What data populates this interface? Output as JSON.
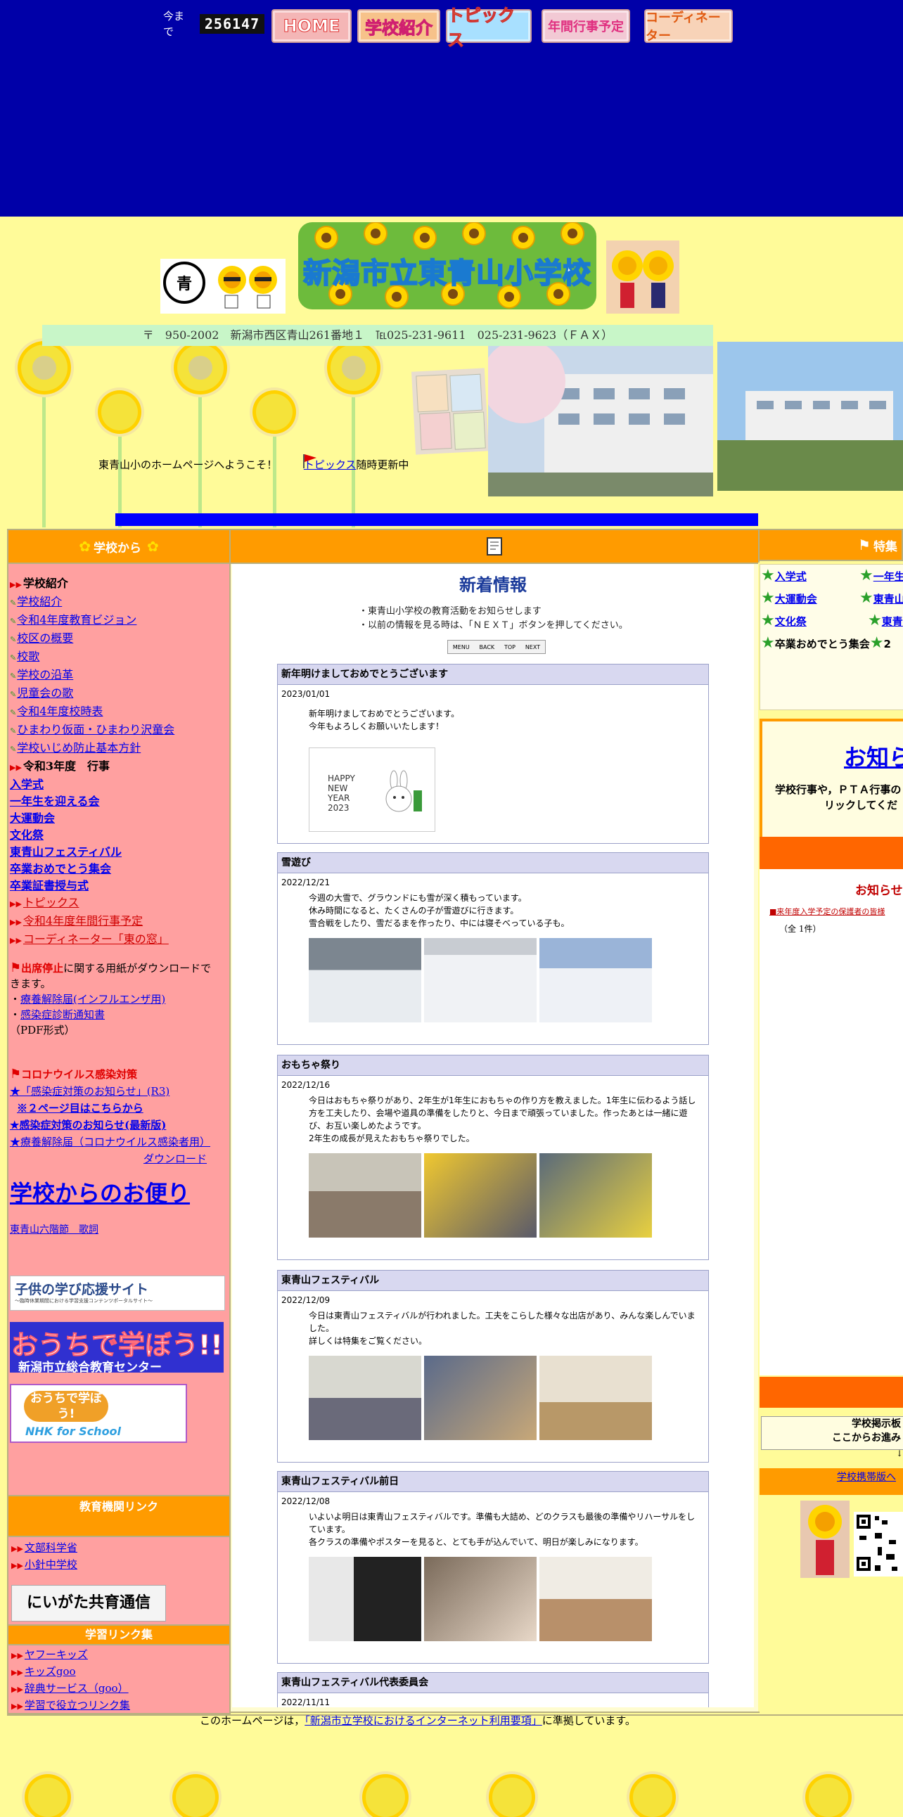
{
  "header": {
    "counter_label": "今まで",
    "counter_value": "256147",
    "nav": [
      "HOME",
      "学校紹介",
      "トピックス",
      "年間行事予定",
      "コーディネーター"
    ]
  },
  "banner": {
    "school_name": "新潟市立東青山小学校",
    "emblem_text": "青",
    "address": "〒　950-2002　新潟市西区青山261番地１　℡025-231-9611　025-231-9623（ＦＡＸ）",
    "welcome": "東青山小のホームページへようこそ！",
    "topics_link": "トピックス",
    "topics_suffix": "随時更新中"
  },
  "left": {
    "header": "学校から",
    "school_intro_title": "学校紹介",
    "school_intro": [
      "学校紹介",
      "令和4年度教育ビジョン",
      "校区の概要",
      "校歌",
      "学校の沿革",
      "児童会の歌",
      "令和4年度校時表",
      "ひまわり仮面・ひまわり沢童会",
      "学校いじめ防止基本方針"
    ],
    "events_title": "令和3年度　行事",
    "events": [
      "入学式",
      "一年生を迎える会",
      "大運動会",
      "文化祭",
      "東青山フェスティバル",
      "卒業おめでとう集会",
      "卒業証書授与式"
    ],
    "other_links": [
      "トピックス",
      "令和4年度年間行事予定",
      "コーディネーター「東の窓」"
    ],
    "attendance_title": "出席停止",
    "attendance_text": "に関する用紙がダウンロードできます。",
    "attendance_links": [
      "療養解除届(インフルエンザ用)",
      "感染症診断通知書"
    ],
    "pdf_note": "（PDF形式）",
    "corona_title": "コロナウイルス感染対策",
    "corona_link1": "★「感染症対策のお知らせ」(R3)",
    "corona_link2": "※２ページ目はこちらから",
    "corona_link3": "★感染症対策のお知らせ(最新版)",
    "corona_link4": "★療養解除届（コロナウイルス感染者用）",
    "download": "ダウンロード",
    "letters": "学校からのお便り",
    "song": "東青山六階節　歌詞",
    "banner1": "子供の学び応援サイト",
    "banner1_sub": "〜臨時休業期間における学習支援コンテンツポータルサイト〜",
    "banner2": "おうちで学ぼう!!",
    "banner2_sub": "新潟市立総合教育センター",
    "banner3": "おうちで学ぼう!",
    "banner3_sub": "NHK for School",
    "edu_links_title": "教育機関リンク",
    "edu_links": [
      "文部科学省",
      "小針中学校"
    ],
    "kyoiku_banner": "にいがた共育通信",
    "study_links_title": "学習リンク集",
    "study_links": [
      "ヤフーキッズ",
      "キッズgoo",
      "辞典サービス（goo）",
      "学習で役立つリンク集"
    ]
  },
  "news": {
    "title": "新着情報",
    "notes": [
      "・東青山小学校の教育活動をお知らせします",
      "・以前の情報を見る時は、「ＮＥＸＴ」ボタンを押してください。"
    ],
    "pager": [
      "MENU",
      "BACK",
      "TOP",
      "NEXT"
    ],
    "items": [
      {
        "title": "新年明けましておめでとうございます",
        "date": "2023/01/01",
        "body": "新年明けましておめでとうございます。\n今年もよろしくお願いいたします！",
        "card": [
          "HAPPY",
          "NEW",
          "YEAR",
          "2023"
        ]
      },
      {
        "title": "雪遊び",
        "date": "2022/12/21",
        "body": "今週の大雪で、グラウンドにも雪が深く積もっています。\n休み時間になると、たくさんの子が雪遊びに行きます。\n雪合戦をしたり、雪だるまを作ったり、中には寝そべっている子も。"
      },
      {
        "title": "おもちゃ祭り",
        "date": "2022/12/16",
        "body": "今日はおもちゃ祭りがあり、2年生が1年生におもちゃの作り方を教えました。1年生に伝わるよう話し方を工夫したり、会場や道具の準備をしたりと、今日まで頑張っていました。作ったあとは一緒に遊び、お互い楽しめたようです。\n2年生の成長が見えたおもちゃ祭りでした。"
      },
      {
        "title": "東青山フェスティバル",
        "date": "2022/12/09",
        "body": "今日は東青山フェスティバルが行われました。工夫をこらした様々な出店があり、みんな楽しんでいました。\n詳しくは特集をご覧ください。"
      },
      {
        "title": "東青山フェスティバル前日",
        "date": "2022/12/08",
        "body": "いよいよ明日は東青山フェスティバルです。準備も大詰め、どのクラスも最後の準備やリハーサルをしています。\n各クラスの準備やポスターを見ると、とても手が込んでいて、明日が楽しみになります。"
      },
      {
        "title": "東青山フェスティバル代表委員会",
        "date": "2022/11/11",
        "body": ""
      }
    ]
  },
  "right": {
    "header": "特集",
    "features": [
      "入学式",
      "一年生",
      "大運動会",
      "東青山",
      "文化祭",
      "東青",
      "卒業おめでとう集会",
      "2"
    ],
    "notice_link": "お知ら",
    "notice_sub": [
      "学校行事や，ＰＴＡ行事の",
      "リックしてくだ"
    ],
    "oshirase_title": "お知らせ",
    "oshirase_item": "■来年度入学予定の保護者の皆様",
    "oshirase_count": "（全 1件）",
    "board_title": "学校掲示板",
    "board_sub": "ここからお進み",
    "board_arrow": "↓",
    "mobile_link": "学校携帯版へ"
  },
  "footer": {
    "prefix": "このホームページは，",
    "link": "「新潟市立学校におけるインターネット利用要項」",
    "suffix": "に準拠しています。"
  }
}
